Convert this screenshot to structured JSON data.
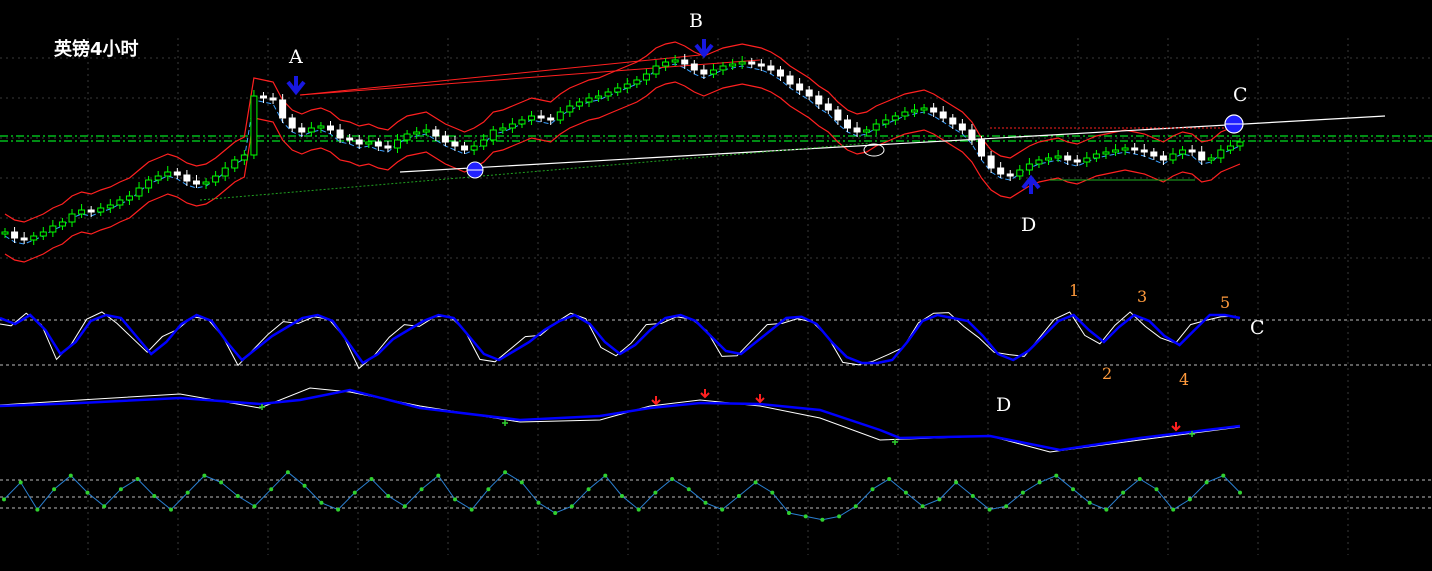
{
  "title": "英镑4小时",
  "colors": {
    "background": "#000000",
    "grid": "#3a3a3a",
    "bull_candle": "#00ff00",
    "bear_candle": "#ffffff",
    "envelope": "#ff2020",
    "midline": "#3aa0ff",
    "trendline": "#ffffff",
    "hline": "#00e020",
    "osc_fast": "#0000ff",
    "osc_slow": "#ffffff",
    "rsi_line": "#2a7fd0",
    "rsi_dots": "#30d030",
    "arrow": "#1818e0",
    "label": "#ffffff",
    "wave_label": "#ff9a3c",
    "signal_marker": "#ff2020"
  },
  "point_labels": [
    {
      "text": "A",
      "arrow": "down"
    },
    {
      "text": "B",
      "arrow": "down"
    },
    {
      "text": "C",
      "arrow": "circle"
    },
    {
      "text": "D",
      "arrow": "up"
    }
  ],
  "wave_labels": [
    "1",
    "2",
    "3",
    "4",
    "5"
  ],
  "oscillator_labels": {
    "c": "C",
    "d": "D"
  },
  "chart_data": [
    {
      "type": "candlestick",
      "title": "英镑4小时",
      "grid": true,
      "panel": "price",
      "note_series": [
        "price candles",
        "envelope bands",
        "trendlines",
        "horizontal level"
      ],
      "close_path": [
        232,
        238,
        240,
        236,
        232,
        226,
        222,
        214,
        210,
        212,
        208,
        205,
        200,
        196,
        188,
        180,
        176,
        172,
        175,
        181,
        184,
        182,
        176,
        168,
        160,
        155,
        96,
        98,
        100,
        118,
        128,
        132,
        128,
        126,
        130,
        138,
        140,
        144,
        142,
        146,
        148,
        140,
        134,
        132,
        130,
        136,
        142,
        146,
        150,
        146,
        140,
        130,
        128,
        124,
        120,
        116,
        118,
        120,
        112,
        106,
        102,
        98,
        96,
        92,
        88,
        84,
        80,
        74,
        66,
        62,
        60,
        64,
        70,
        74,
        70,
        66,
        64,
        62,
        64,
        66,
        70,
        76,
        84,
        90,
        96,
        104,
        110,
        120,
        128,
        132,
        130,
        124,
        120,
        116,
        112,
        110,
        108,
        112,
        118,
        124,
        130,
        140,
        156,
        168,
        174,
        176,
        170,
        164,
        160,
        158,
        156,
        160,
        162,
        158,
        154,
        152,
        150,
        148,
        150,
        152,
        156,
        160,
        154,
        150,
        152,
        160,
        158,
        150,
        146,
        142
      ],
      "stoch_path": [
        0.9,
        0.8,
        0.95,
        0.7,
        0.3,
        0.5,
        0.85,
        0.95,
        0.9,
        0.6,
        0.3,
        0.5,
        0.8,
        0.95,
        0.85,
        0.5,
        0.2,
        0.4,
        0.6,
        0.75,
        0.9,
        0.95,
        0.85,
        0.5,
        0.15,
        0.3,
        0.55,
        0.7,
        0.85,
        0.95,
        0.9,
        0.6,
        0.3,
        0.2,
        0.35,
        0.5,
        0.7,
        0.85,
        0.95,
        0.8,
        0.5,
        0.3,
        0.45,
        0.7,
        0.9,
        0.95,
        0.85,
        0.6,
        0.35,
        0.3,
        0.5,
        0.7,
        0.9,
        0.92,
        0.8,
        0.5,
        0.25,
        0.15,
        0.15,
        0.2,
        0.5,
        0.85,
        0.95,
        0.9,
        0.85,
        0.6,
        0.3,
        0.2,
        0.35,
        0.6,
        0.85,
        0.95,
        0.7,
        0.5,
        0.75,
        0.95,
        0.85,
        0.6,
        0.45,
        0.7,
        0.95,
        0.95,
        0.9
      ],
      "rsi_path": [
        0.45,
        0.7,
        0.3,
        0.6,
        0.8,
        0.55,
        0.35,
        0.6,
        0.75,
        0.5,
        0.3,
        0.55,
        0.8,
        0.7,
        0.5,
        0.35,
        0.6,
        0.85,
        0.65,
        0.4,
        0.3,
        0.55,
        0.75,
        0.5,
        0.35,
        0.6,
        0.8,
        0.45,
        0.3,
        0.6,
        0.85,
        0.7,
        0.4,
        0.25,
        0.35,
        0.6,
        0.8,
        0.5,
        0.3,
        0.55,
        0.75,
        0.6,
        0.4,
        0.3,
        0.5,
        0.7,
        0.55,
        0.25,
        0.2,
        0.15,
        0.2,
        0.35,
        0.6,
        0.75,
        0.55,
        0.35,
        0.45,
        0.7,
        0.5,
        0.3,
        0.35,
        0.55,
        0.7,
        0.8,
        0.6,
        0.4,
        0.3,
        0.55,
        0.75,
        0.6,
        0.3,
        0.45,
        0.7,
        0.8,
        0.55
      ]
    }
  ]
}
